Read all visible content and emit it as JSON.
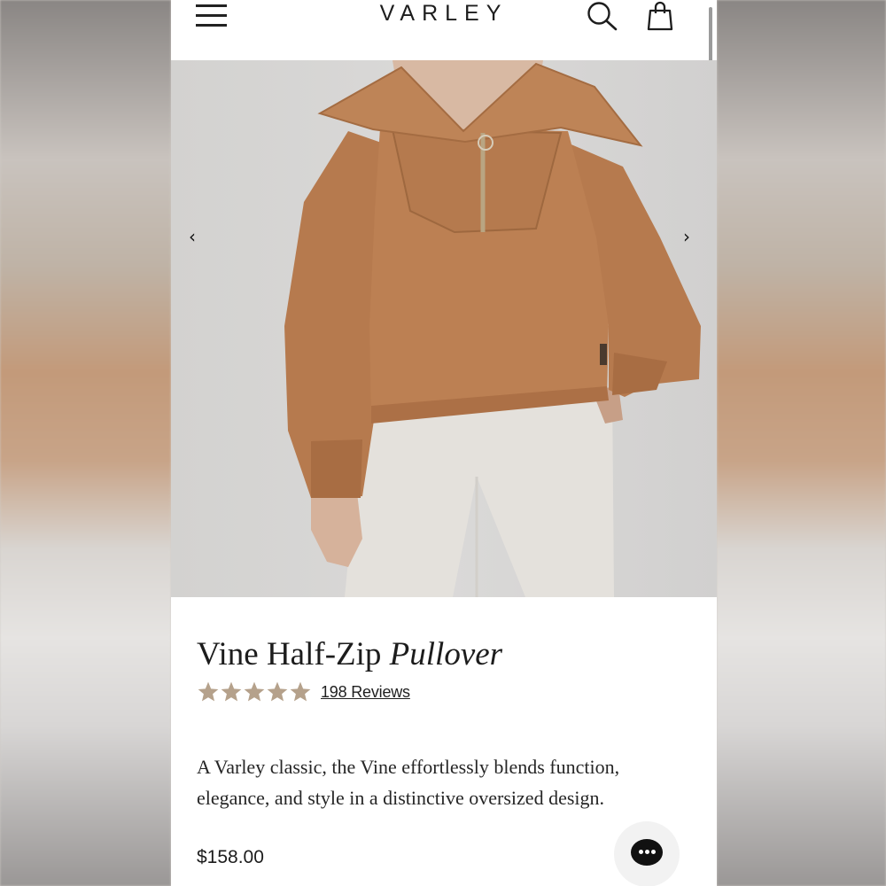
{
  "header": {
    "brand": "VARLEY",
    "menu_icon": "hamburger-menu-icon",
    "search_icon": "search-icon",
    "bag_icon": "shopping-bag-icon"
  },
  "gallery": {
    "image_alt": "Model wearing camel half-zip pullover with oversized collar and light grey joggers",
    "prev_icon": "chevron-left-icon",
    "next_icon": "chevron-right-icon",
    "prev_glyph": "‹",
    "next_glyph": "›"
  },
  "product": {
    "name_regular": "Vine Half-Zip",
    "name_italic": "Pullover",
    "rating": 5,
    "reviews_label": "198 Reviews",
    "description": "A Varley classic, the Vine effortlessly blends function, elegance, and style in a distinctive oversized design.",
    "price": "$158.00"
  },
  "chat": {
    "icon": "chat-bubble-icon"
  },
  "colors": {
    "star": "#b5a18b",
    "sweater": "#b57a4f",
    "text": "#1c1c1c"
  }
}
